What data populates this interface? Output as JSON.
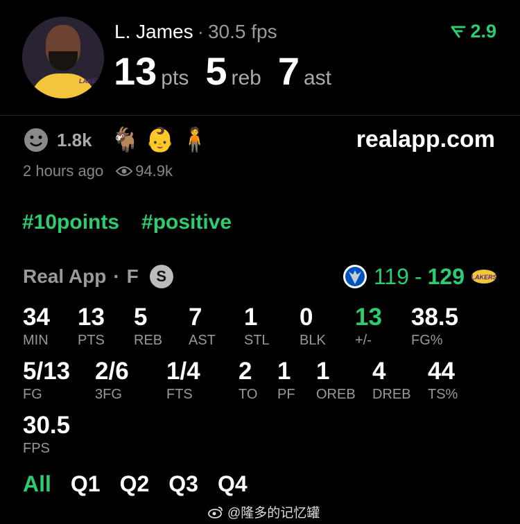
{
  "header": {
    "player_name": "L. James",
    "fps": "30.5 fps",
    "delta": "2.9",
    "stats": [
      {
        "value": "13",
        "unit": "pts"
      },
      {
        "value": "5",
        "unit": "reb"
      },
      {
        "value": "7",
        "unit": "ast"
      }
    ]
  },
  "reactions": {
    "count": "1.8k",
    "icons": [
      "smiley-icon",
      "goat-icon",
      "baby-icon",
      "person-icon"
    ]
  },
  "site": "realapp.com",
  "meta": {
    "time": "2 hours ago",
    "views": "94.9k"
  },
  "tags": [
    "#10points",
    "#positive"
  ],
  "source": {
    "name": "Real App",
    "separator": "·",
    "position": "F",
    "badge": "S"
  },
  "score": {
    "away": "119",
    "dash": "-",
    "home": "129"
  },
  "box": [
    {
      "value": "34",
      "label": "MIN"
    },
    {
      "value": "13",
      "label": "PTS"
    },
    {
      "value": "5",
      "label": "REB"
    },
    {
      "value": "7",
      "label": "AST"
    },
    {
      "value": "1",
      "label": "STL"
    },
    {
      "value": "0",
      "label": "BLK"
    },
    {
      "value": "13",
      "label": "+/-"
    },
    {
      "value": "38.5",
      "label": "FG%"
    },
    {
      "value": "5/13",
      "label": "FG"
    },
    {
      "value": "2/6",
      "label": "3FG"
    },
    {
      "value": "1/4",
      "label": "FTS"
    },
    {
      "value": "2",
      "label": "TO"
    },
    {
      "value": "1",
      "label": "PF"
    },
    {
      "value": "1",
      "label": "OREB"
    },
    {
      "value": "4",
      "label": "DREB"
    },
    {
      "value": "44",
      "label": "TS%"
    },
    {
      "value": "30.5",
      "label": "FPS"
    }
  ],
  "quarters": [
    "All",
    "Q1",
    "Q2",
    "Q3",
    "Q4"
  ],
  "watermark": "@隆多的记忆罐",
  "colors": {
    "accent": "#2ecc71",
    "background": "#000000"
  }
}
